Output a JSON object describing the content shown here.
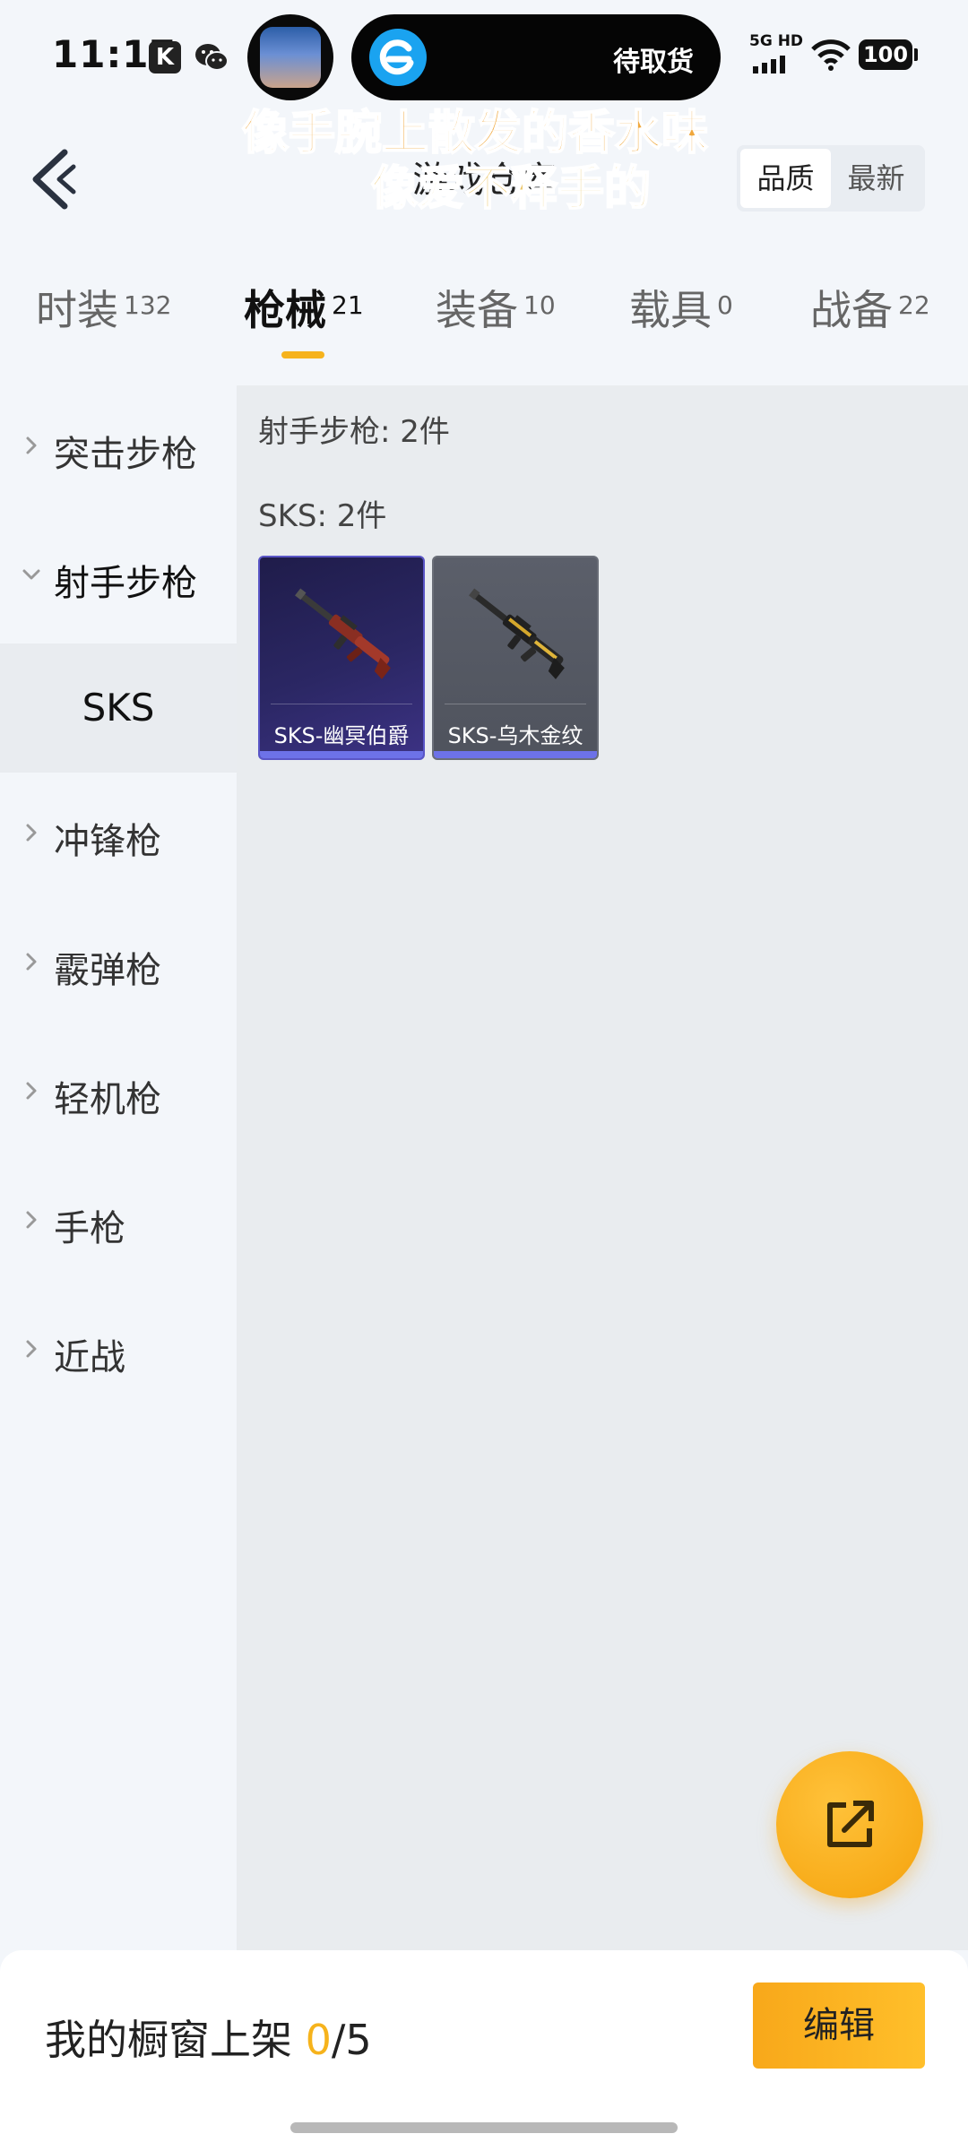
{
  "status_bar": {
    "time": "11:17",
    "k_badge": "K",
    "island_text": "待取货",
    "network": "5G HD",
    "battery": "100"
  },
  "header": {
    "title": "游戏仓库",
    "sort_options": [
      "品质",
      "最新"
    ],
    "active_sort": "品质"
  },
  "lyrics": {
    "line1": "像手腕上散发的香水味",
    "line2": "像爱不释手的"
  },
  "tabs": [
    {
      "label": "时装",
      "count": "132"
    },
    {
      "label": "枪械",
      "count": "21"
    },
    {
      "label": "装备",
      "count": "10"
    },
    {
      "label": "载具",
      "count": "0"
    },
    {
      "label": "战备",
      "count": "22"
    }
  ],
  "active_tab": "枪械",
  "sidebar": {
    "items": [
      {
        "label": "突击步枪"
      },
      {
        "label": "射手步枪"
      },
      {
        "label": "冲锋枪"
      },
      {
        "label": "霰弹枪"
      },
      {
        "label": "轻机枪"
      },
      {
        "label": "手枪"
      },
      {
        "label": "近战"
      }
    ],
    "sub_item": "SKS"
  },
  "main": {
    "category_title": "射手步枪: 2件",
    "group_title": "SKS: 2件",
    "items": [
      {
        "name": "SKS-幽冥伯爵"
      },
      {
        "name": "SKS-乌木金纹"
      }
    ]
  },
  "bottom_bar": {
    "showcase_label": "我的橱窗上架",
    "showcase_count": "0",
    "showcase_total": "/5",
    "edit_label": "编辑"
  }
}
